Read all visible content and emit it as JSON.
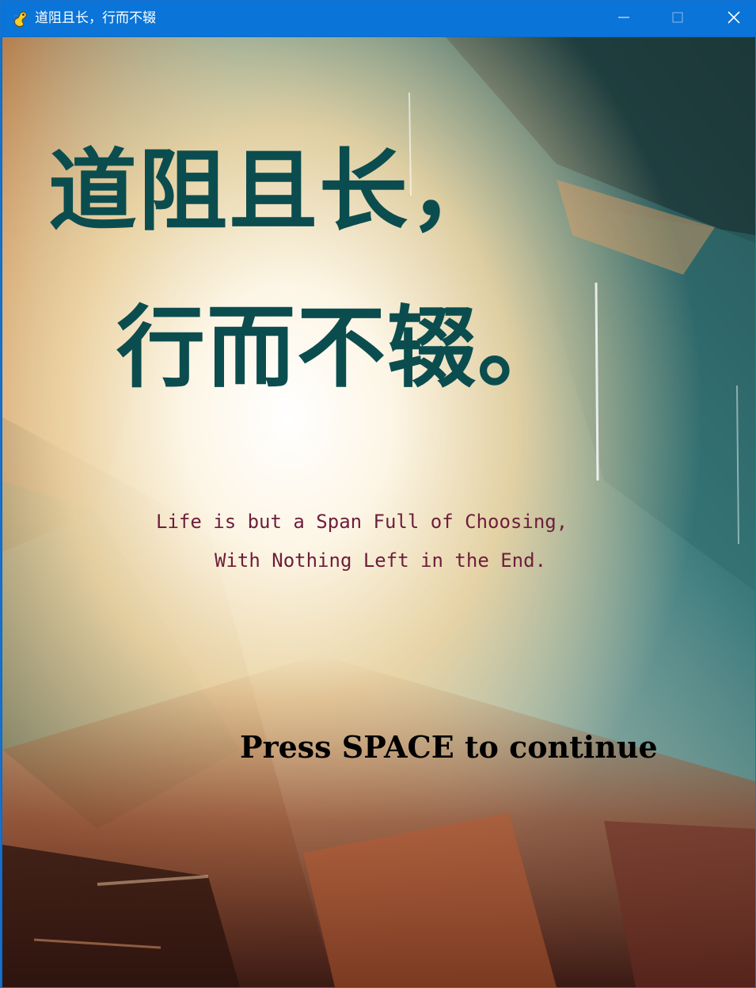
{
  "window": {
    "title": "道阻且长，行而不辍",
    "app_icon": "pygame-snake-icon",
    "controls": {
      "minimize_icon": "minimize-icon",
      "maximize_icon": "maximize-icon",
      "close_icon": "close-icon"
    }
  },
  "screen": {
    "title_line_1": "道阻且长，",
    "title_line_2": "行而不辍。",
    "subtitle_line_1": "Life is but a Span Full of Choosing,",
    "subtitle_line_2": "With Nothing Left in the End.",
    "prompt": "Press SPACE to continue",
    "background": "abstract oil painting with warm orange, cream and teal strokes",
    "colors": {
      "titlebar": "#0a74d8",
      "title_text": "#0b4d4f",
      "subtitle_text": "#6d1e3b",
      "prompt_text": "#000000"
    }
  }
}
